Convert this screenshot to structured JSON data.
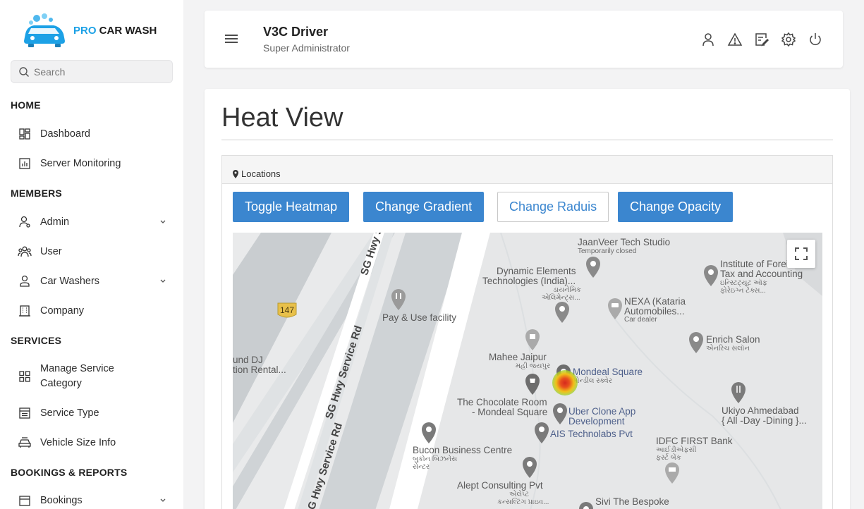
{
  "brand": {
    "pro": "PRO",
    "rest": " CAR WASH"
  },
  "search": {
    "placeholder": "Search"
  },
  "sidebar": {
    "sections": {
      "home": "HOME",
      "members": "MEMBERS",
      "services": "SERVICES",
      "bookings": "BOOKINGS & REPORTS"
    },
    "items": {
      "dashboard": "Dashboard",
      "server_monitoring": "Server Monitoring",
      "admin": "Admin",
      "user": "User",
      "car_washers": "Car Washers",
      "company": "Company",
      "manage_service_category_1": "Manage Service",
      "manage_service_category_2": "Category",
      "service_type": "Service Type",
      "vehicle_size_info": "Vehicle Size Info",
      "bookings": "Bookings"
    }
  },
  "header": {
    "user_name": "V3C Driver",
    "user_role": "Super Administrator",
    "icons": [
      "user-icon",
      "alert-icon",
      "edit-icon",
      "settings-icon",
      "power-icon"
    ]
  },
  "page": {
    "title": "Heat View",
    "panel_title": "Locations",
    "buttons": {
      "toggle": "Toggle Heatmap",
      "gradient": "Change Gradient",
      "radius": "Change Raduis",
      "opacity": "Change Opacity"
    }
  },
  "map": {
    "road_badge": "147",
    "labels": {
      "jaanveer": "JaanVeer Tech Studio",
      "temp_closed": "Temporarily closed",
      "dynamic_1": "Dynamic Elements",
      "dynamic_2": "Technologies (India)...",
      "dynamic_3": "ડાયનેમિક",
      "dynamic_4": "એલિમેન્ટ્સ...",
      "institute_1": "Institute of Forei",
      "institute_2": "Tax and Accounting",
      "institute_3": "ઇન્સ્ટિટ્યૂટ ઑફ",
      "institute_4": "ફોરેઇગ્ન ટૅક્સ...",
      "pay_use": "Pay & Use facility",
      "nexa_1": "NEXA (Kataria",
      "nexa_2": "Automobiles...",
      "car_dealer": "Car dealer",
      "enrich_1": "Enrich Salon",
      "enrich_2": "એનરિચ સલૉન",
      "dj_1": "und DJ",
      "dj_2": "tion Rental...",
      "mahee_1": "Mahee Jaipur",
      "mahee_2": "મહી જયપુર",
      "mondeal_1": "Mondeal Square",
      "mondeal_2": "મોન્ડીલ સ્ક્વેર",
      "choco_1": "The Chocolate Room",
      "choco_2": "- Mondeal Square",
      "uber_1": "Uber Clone App",
      "uber_2": "Development",
      "ais": "AIS Technolabs Pvt",
      "ukiyo_1": "Ukiyo Ahmedabad",
      "ukiyo_2": "{ All -Day -Dining }...",
      "idfc_1": "IDFC FIRST Bank",
      "idfc_2": "આઈડીએફસી",
      "idfc_3": "ફર્સ્ટ બેંક",
      "bucon_1": "Bucon Business Centre",
      "bucon_2": "બુકોન બિઝનેસ",
      "bucon_3": "સેન્ટર",
      "alept_1": "Alept Consulting Pvt",
      "alept_2": "એલેપ્ટ",
      "alept_3": "કન્સલ્ટિંગ પ્રાઇવ...",
      "sivi": "Sivi The Bespoke",
      "road_1": "SG Hwy Servi",
      "road_2": "SG Hwy Service Rd",
      "road_3": "SG Hwy Service Rd"
    }
  }
}
